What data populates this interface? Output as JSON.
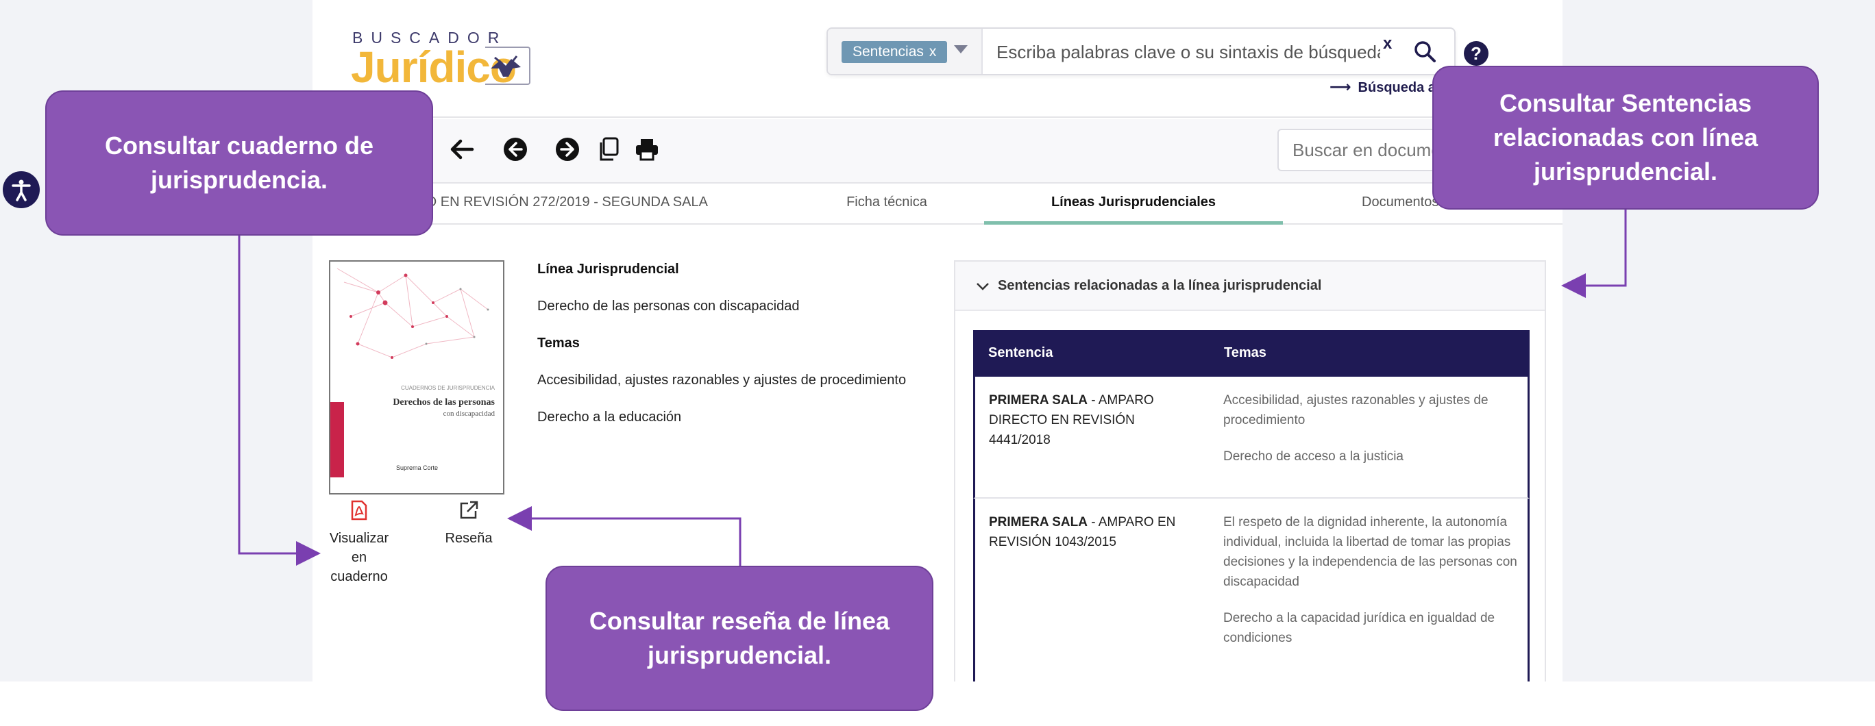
{
  "header": {
    "logo_top": "BUSCADOR",
    "logo_main": "Jurídico",
    "search_chip": "Sentencias",
    "chip_remove": "x",
    "search_placeholder": "Escriba palabras clave o su sintaxis de búsqueda",
    "clear_label": "x",
    "help_label": "?",
    "advanced_search": "Búsqueda avanzada"
  },
  "toolbar": {
    "doc_search_placeholder": "Buscar en documento"
  },
  "tabs": [
    {
      "label": "AMPARO EN REVISIÓN 272/2019 - SEGUNDA SALA"
    },
    {
      "label": "Ficha técnica"
    },
    {
      "label": "Líneas Jurisprudenciales"
    },
    {
      "label": "Documentos asociados"
    }
  ],
  "cover": {
    "series": "CUADERNOS DE JURISPRUDENCIA",
    "title": "Derechos de las personas",
    "subtitle": "con discapacidad",
    "publisher": "Suprema Corte"
  },
  "actions": {
    "view_notebook": [
      "Visualizar",
      "en",
      "cuaderno"
    ],
    "review": "Reseña"
  },
  "info": {
    "line_label": "Línea Jurisprudencial",
    "line_value": "Derecho de las personas con discapacidad",
    "topics_label": "Temas",
    "topics": [
      "Accesibilidad, ajustes razonables y ajustes de procedimiento",
      "Derecho a la educación"
    ]
  },
  "panel": {
    "title": "Sentencias relacionadas a la línea jurisprudencial",
    "col_sentencia": "Sentencia",
    "col_temas": "Temas",
    "rows": [
      {
        "sala": "PRIMERA SALA",
        "case": " - AMPARO DIRECTO EN REVISIÓN 4441/2018",
        "topic1": "Accesibilidad, ajustes razonables y ajustes de procedimiento",
        "topic2": "Derecho de acceso a la justicia"
      },
      {
        "sala": "PRIMERA SALA",
        "case": " - AMPARO EN REVISIÓN 1043/2015",
        "topic1": "El respeto de la dignidad inherente, la autonomía individual, incluida la libertad de tomar las propias decisiones y la independencia de las personas con discapacidad",
        "topic2": "Derecho a la capacidad jurídica en igualdad de condiciones"
      }
    ]
  },
  "callouts": {
    "cuaderno": "Consultar cuaderno de jurisprudencia.",
    "sentencias": "Consultar Sentencias relacionadas con línea jurisprudencial.",
    "resena": "Consultar reseña de línea jurisprudencial."
  },
  "colors": {
    "navy": "#1f1a55",
    "accent_gold": "#f2b73a",
    "callout_purple": "#8a55b4",
    "tab_underline": "#7fbfac",
    "chip": "#6f97b3"
  }
}
